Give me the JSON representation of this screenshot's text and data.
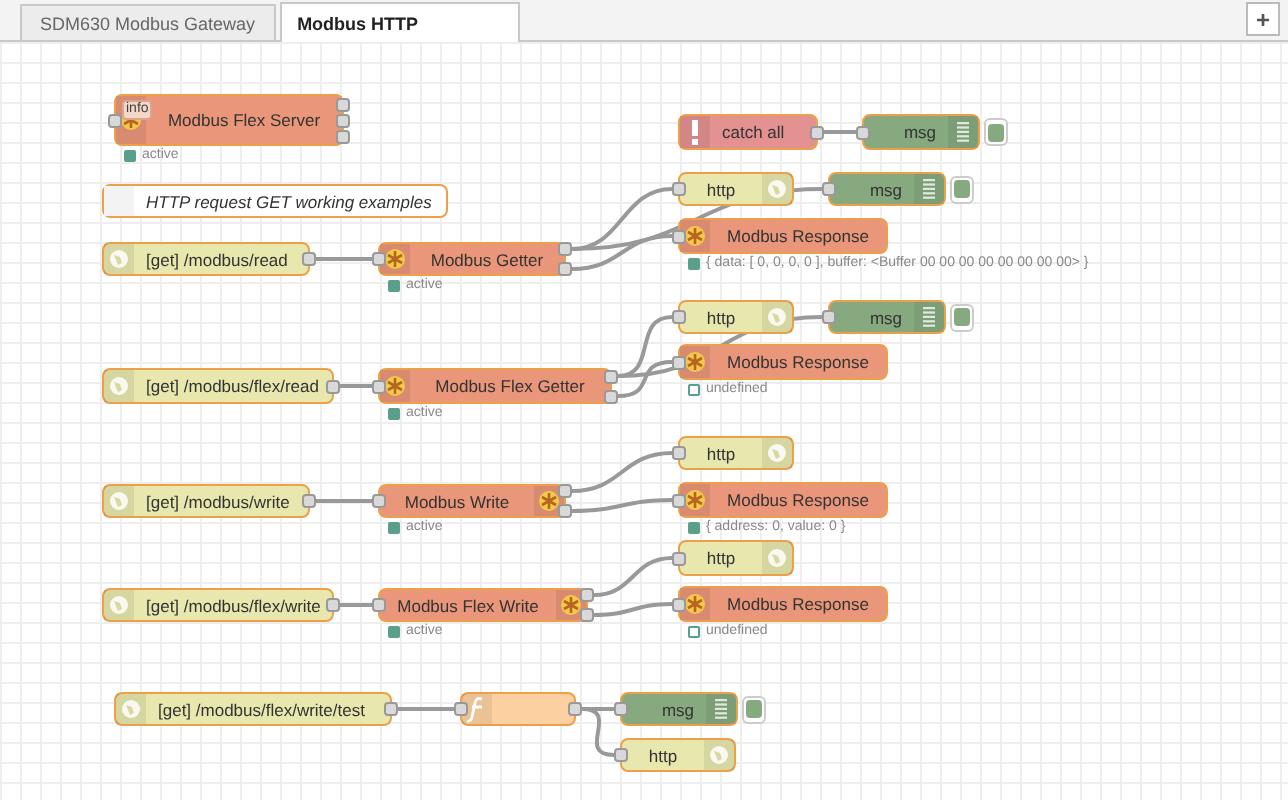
{
  "tabs": [
    {
      "label": "SDM630 Modbus Gateway",
      "selected": false
    },
    {
      "label": "Modbus HTTP",
      "selected": true
    }
  ],
  "add_tab_button": "+",
  "nodes": [
    {
      "kind": "modbus",
      "label": "Modbus Flex Server",
      "icon_right": false,
      "badge": "info",
      "status": {
        "filled": true,
        "text": "active"
      }
    },
    {
      "kind": "comment",
      "label": "HTTP request GET working examples"
    },
    {
      "kind": "inject",
      "label": "[get] /modbus/read"
    },
    {
      "kind": "modbus",
      "label": "Modbus Getter",
      "icon_right": false,
      "status": {
        "filled": true,
        "text": "active"
      }
    },
    {
      "kind": "catch",
      "label": "catch all"
    },
    {
      "kind": "debug",
      "label": "msg"
    },
    {
      "kind": "http",
      "label": "http"
    },
    {
      "kind": "debug",
      "label": "msg"
    },
    {
      "kind": "modbus",
      "label": "Modbus Response",
      "icon_right": false,
      "status": {
        "filled": true,
        "text": "{ data: [ 0, 0, 0, 0 ], buffer: <Buffer 00 00 00 00 00 00 00 00> }"
      }
    },
    {
      "kind": "inject",
      "label": "[get] /modbus/flex/read"
    },
    {
      "kind": "modbus",
      "label": "Modbus Flex Getter",
      "icon_right": false,
      "status": {
        "filled": true,
        "text": "active"
      }
    },
    {
      "kind": "http",
      "label": "http"
    },
    {
      "kind": "debug",
      "label": "msg"
    },
    {
      "kind": "modbus",
      "label": "Modbus Response",
      "icon_right": false,
      "status": {
        "filled": false,
        "text": "undefined"
      }
    },
    {
      "kind": "inject",
      "label": "[get] /modbus/write"
    },
    {
      "kind": "modbus",
      "label": "Modbus Write",
      "icon_right": true,
      "status": {
        "filled": true,
        "text": "active"
      }
    },
    {
      "kind": "http",
      "label": "http"
    },
    {
      "kind": "modbus",
      "label": "Modbus Response",
      "icon_right": false,
      "status": {
        "filled": true,
        "text": "{ address: 0, value: 0 }"
      }
    },
    {
      "kind": "inject",
      "label": "[get] /modbus/flex/write"
    },
    {
      "kind": "modbus",
      "label": "Modbus Flex Write",
      "icon_right": true,
      "status": {
        "filled": true,
        "text": "active"
      }
    },
    {
      "kind": "http",
      "label": "http"
    },
    {
      "kind": "modbus",
      "label": "Modbus Response",
      "icon_right": false,
      "status": {
        "filled": false,
        "text": "undefined"
      }
    },
    {
      "kind": "inject",
      "label": "[get] /modbus/flex/write/test"
    },
    {
      "kind": "function"
    },
    {
      "kind": "debug",
      "label": "msg"
    },
    {
      "kind": "http",
      "label": "http"
    }
  ]
}
